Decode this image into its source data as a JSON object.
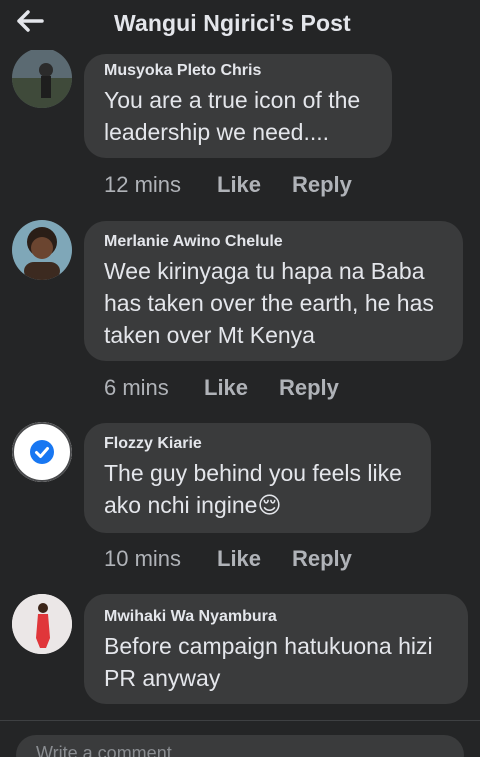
{
  "header": {
    "title": "Wangui Ngirici's Post"
  },
  "comments": [
    {
      "author": "Musyoka Pleto Chris",
      "lines": [
        "You are a true icon of the",
        "leadership we need...."
      ],
      "time": "12 mins",
      "like": "Like",
      "reply": "Reply"
    },
    {
      "author": "Merlanie Awino Chelule",
      "lines": [
        "Wee kirinyaga tu hapa na Baba",
        "has taken over the earth, he has",
        "taken over Mt Kenya"
      ],
      "time": "6 mins",
      "like": "Like",
      "reply": "Reply"
    },
    {
      "author": "Flozzy Kiarie",
      "lines": [
        "The guy behind you feels like",
        "ako nchi ingine"
      ],
      "emoji": "😌",
      "time": "10 mins",
      "like": "Like",
      "reply": "Reply"
    },
    {
      "author": "Mwihaki Wa Nyambura",
      "lines": [
        "Before campaign hatukuona hizi",
        "PR anyway"
      ]
    }
  ],
  "composer": {
    "placeholder": "Write a comment..."
  },
  "colors": {
    "background": "#242526",
    "bubble": "#3a3b3c",
    "text": "#e4e6eb",
    "muted": "#b0b3b8",
    "badge_blue": "#1877f2"
  },
  "icons": {
    "back": "arrow-left",
    "verified": "check-circle"
  }
}
